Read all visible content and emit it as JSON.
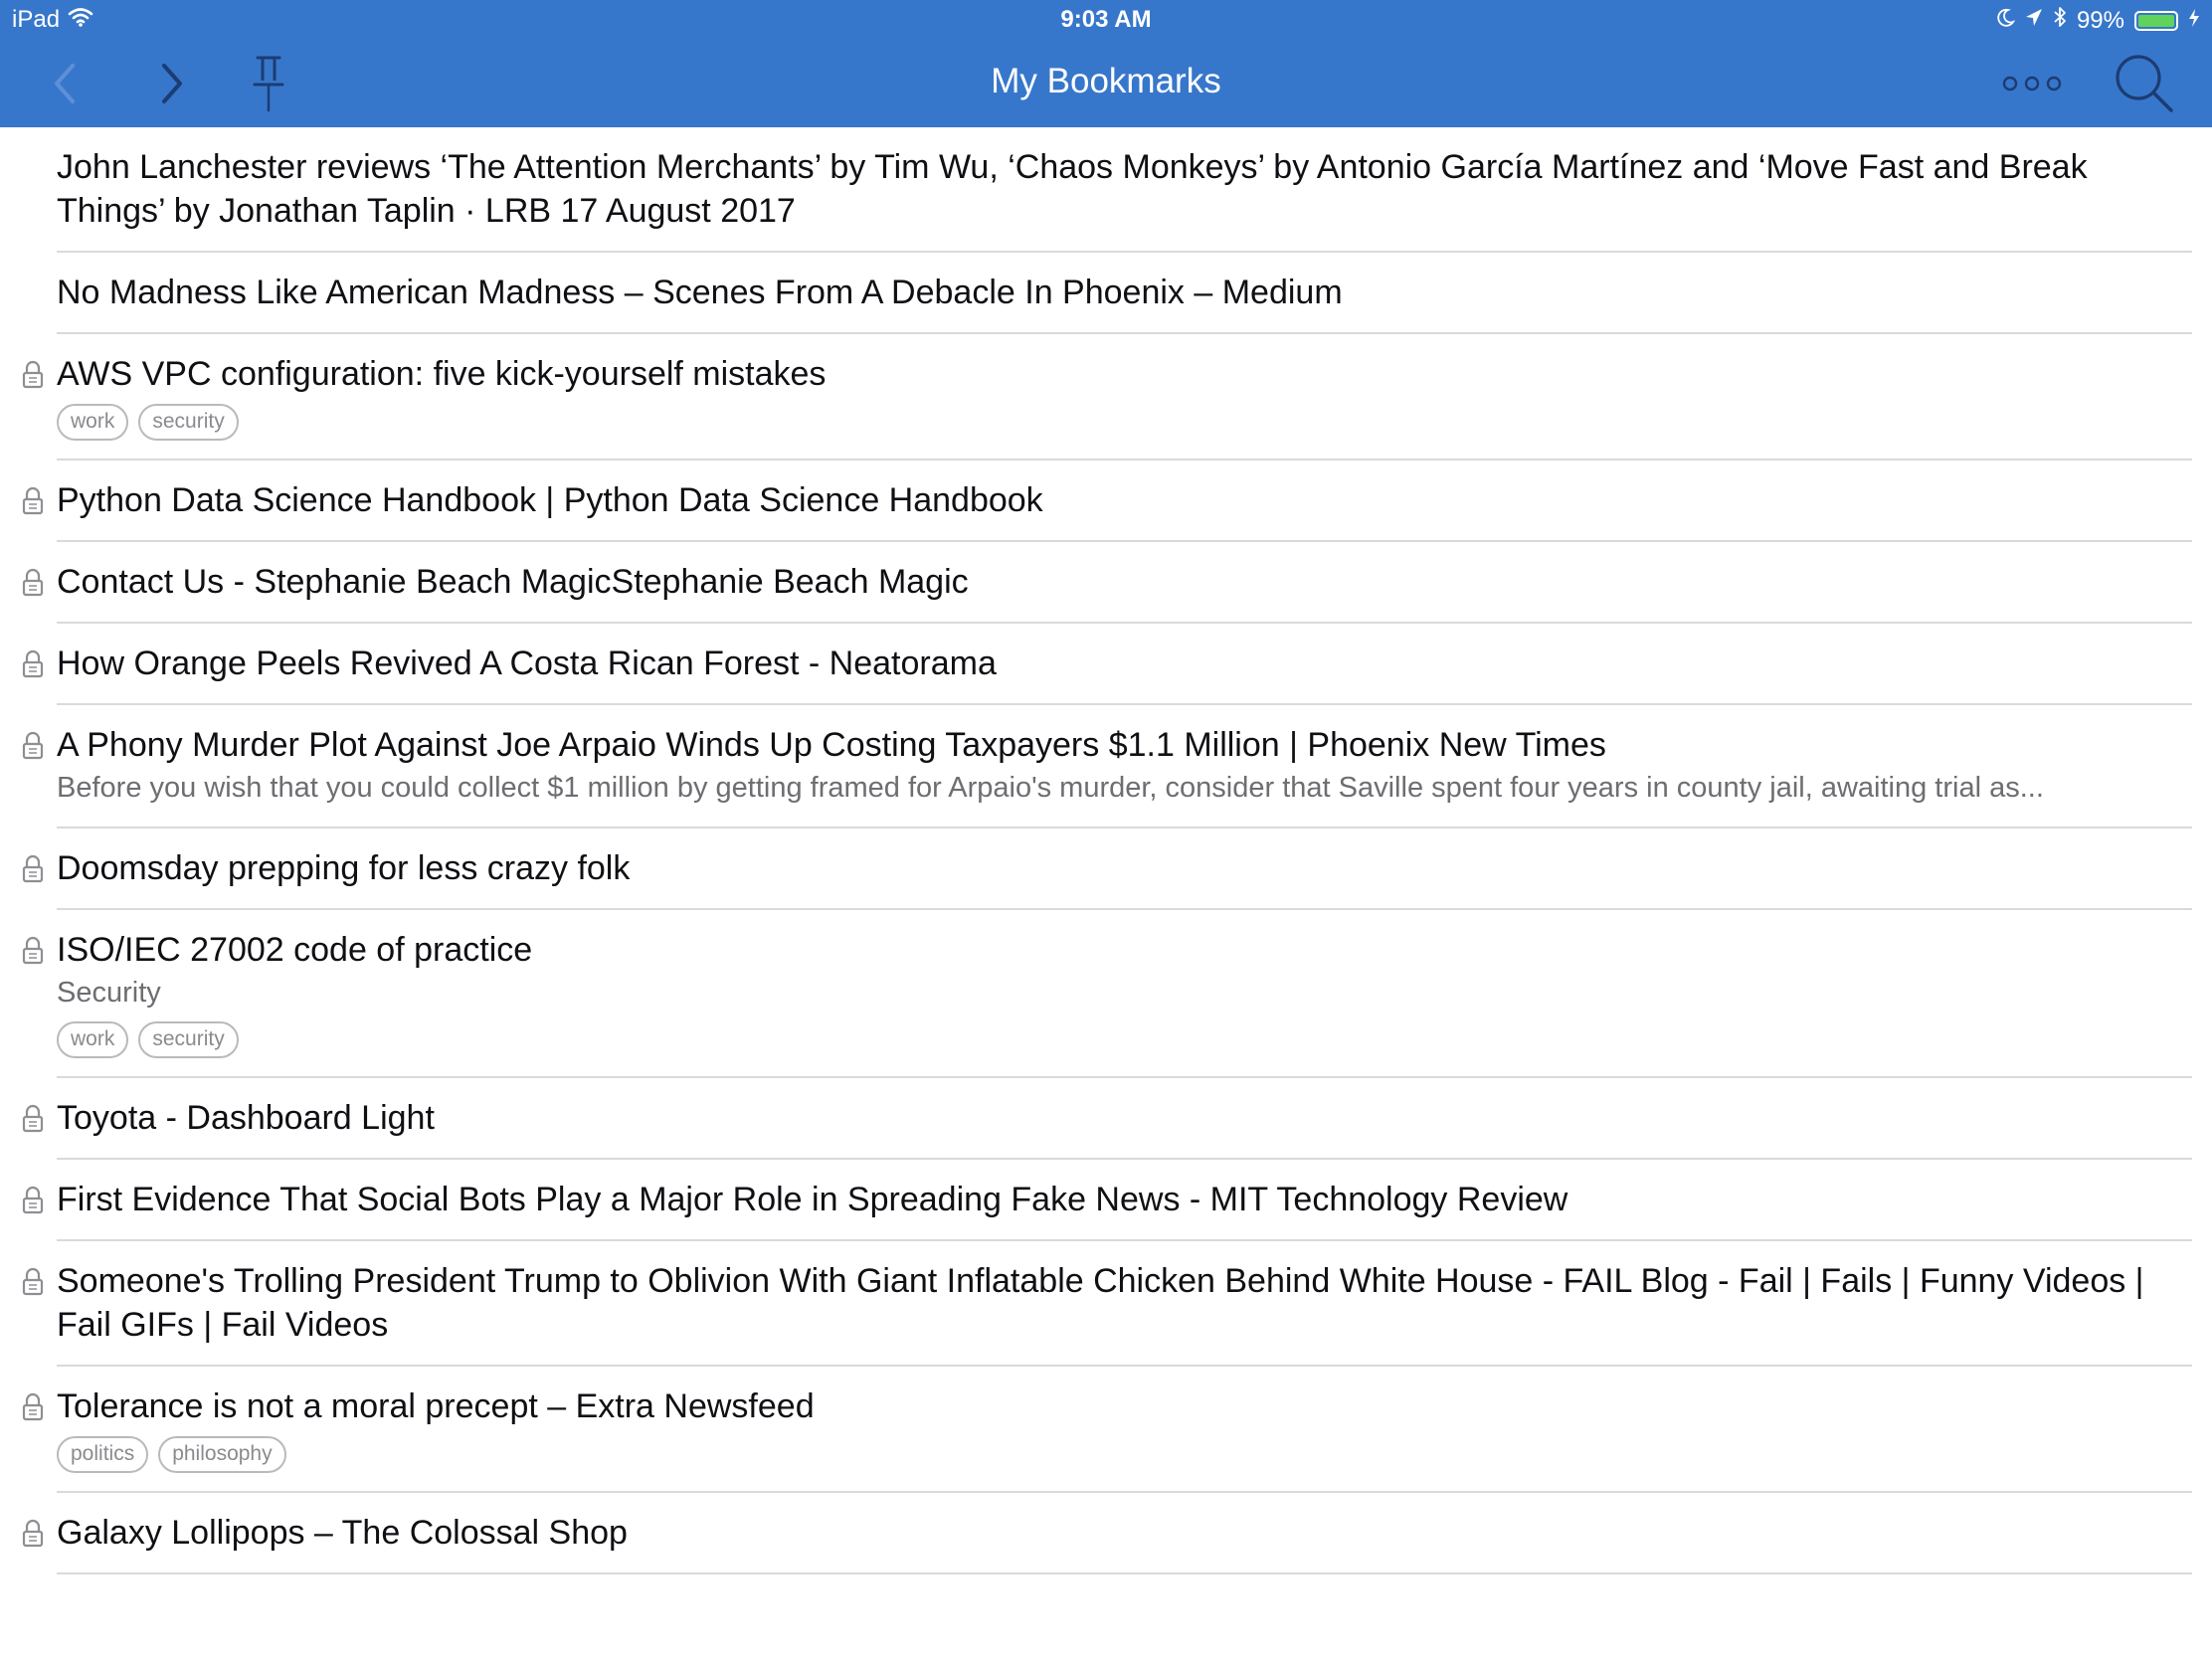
{
  "status_bar": {
    "device": "iPad",
    "time": "9:03 AM",
    "battery_text": "99%",
    "battery_level": 0.99
  },
  "nav": {
    "title": "My Bookmarks",
    "back_icon": "chevron-left-icon",
    "forward_icon": "chevron-right-icon",
    "pin_icon": "pin-icon",
    "more_icon": "more-icon",
    "search_icon": "search-icon"
  },
  "colors": {
    "header": "#3777cb",
    "separator": "#d9d9de",
    "title_text": "#0f0f14",
    "secondary_text": "#6d6d72"
  },
  "bookmarks": [
    {
      "title": "John Lanchester reviews ‘The Attention Merchants’ by Tim Wu, ‘Chaos Monkeys’ by Antonio García Martínez and ‘Move Fast and Break Things’ by Jonathan Taplin · LRB 17 August 2017",
      "private": false
    },
    {
      "title": "No Madness Like American Madness – Scenes From A Debacle In Phoenix – Medium",
      "private": false
    },
    {
      "title": "AWS VPC configuration: five kick-yourself mistakes",
      "private": true,
      "tags": [
        "work",
        "security"
      ]
    },
    {
      "title": "Python Data Science Handbook | Python Data Science Handbook",
      "private": true
    },
    {
      "title": "Contact Us - Stephanie Beach MagicStephanie Beach Magic",
      "private": true
    },
    {
      "title": "How Orange Peels Revived A Costa Rican Forest - Neatorama",
      "private": true
    },
    {
      "title": "A Phony Murder Plot Against Joe Arpaio Winds Up Costing Taxpayers $1.1 Million | Phoenix New Times",
      "private": true,
      "description": "Before you wish that you could collect $1 million by getting framed for Arpaio's murder, consider that Saville spent four years in county jail, awaiting trial as..."
    },
    {
      "title": "Doomsday prepping for less crazy folk",
      "private": true
    },
    {
      "title": "ISO/IEC 27002 code of practice",
      "private": true,
      "description": "Security",
      "tags": [
        "work",
        "security"
      ]
    },
    {
      "title": "Toyota - Dashboard Light",
      "private": true
    },
    {
      "title": "First Evidence That Social Bots Play a Major Role in Spreading Fake News - MIT Technology Review",
      "private": true
    },
    {
      "title": "Someone's Trolling President Trump to Oblivion With Giant Inflatable Chicken Behind White House - FAIL Blog - Fail | Fails | Funny Videos | Fail GIFs | Fail Videos",
      "private": true
    },
    {
      "title": "Tolerance is not a moral precept – Extra Newsfeed",
      "private": true,
      "tags": [
        "politics",
        "philosophy"
      ]
    },
    {
      "title": "Galaxy Lollipops – The Colossal Shop",
      "private": true
    }
  ]
}
